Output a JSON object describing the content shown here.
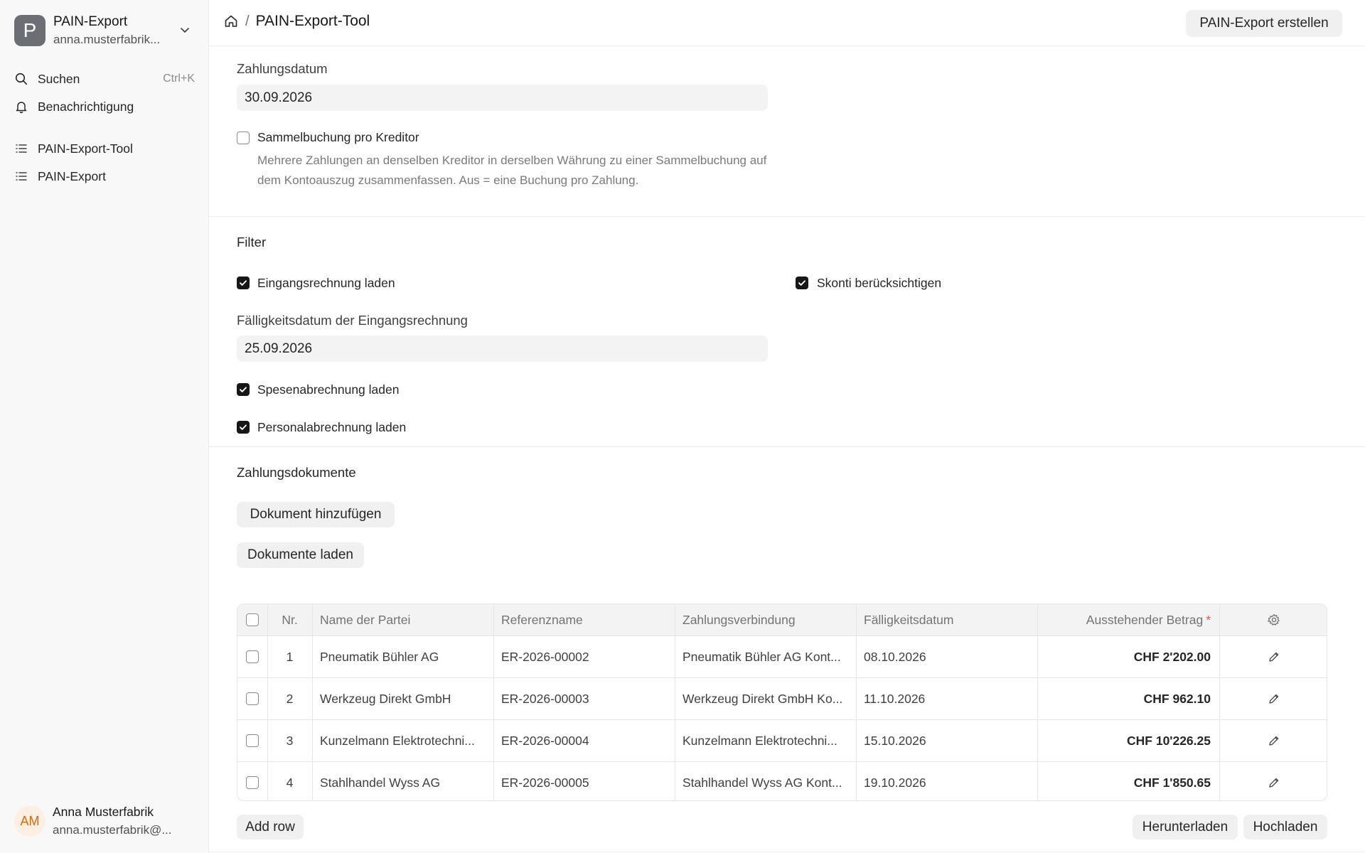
{
  "sidebar": {
    "workspace": {
      "logo_letter": "P",
      "title": "PAIN-Export",
      "subtitle": "anna.musterfabrik..."
    },
    "search": {
      "label": "Suchen",
      "shortcut": "Ctrl+K"
    },
    "notifications": {
      "label": "Benachrichtigung"
    },
    "items": [
      {
        "label": "PAIN-Export-Tool"
      },
      {
        "label": "PAIN-Export"
      }
    ],
    "user": {
      "initials": "AM",
      "name": "Anna Musterfabrik",
      "email": "anna.musterfabrik@..."
    }
  },
  "header": {
    "breadcrumb_current": "PAIN-Export-Tool",
    "primary_action": "PAIN-Export erstellen"
  },
  "form": {
    "payment_date": {
      "label": "Zahlungsdatum",
      "value": "30.09.2026"
    },
    "collective_booking": {
      "label": "Sammelbuchung pro Kreditor",
      "checked": false,
      "description": "Mehrere Zahlungen an denselben Kreditor in derselben Währung zu einer Sammelbuchung auf dem Kontoauszug zusammenfassen. Aus = eine Buchung pro Zahlung."
    },
    "filter": {
      "title": "Filter",
      "load_purchase_invoices": {
        "label": "Eingangsrechnung laden",
        "checked": true
      },
      "consider_discounts": {
        "label": "Skonti berücksichtigen",
        "checked": true
      },
      "due_date": {
        "label": "Fälligkeitsdatum der Eingangsrechnung",
        "value": "25.09.2026"
      },
      "load_expense_claims": {
        "label": "Spesenabrechnung laden",
        "checked": true
      },
      "load_payroll": {
        "label": "Personalabrechnung laden",
        "checked": true
      }
    },
    "documents": {
      "title": "Zahlungsdokumente",
      "add_button": "Dokument hinzufügen",
      "load_button": "Dokumente laden",
      "columns": [
        "Nr.",
        "Name der Partei",
        "Referenzname",
        "Zahlungsverbindung",
        "Fälligkeitsdatum",
        "Ausstehender Betrag"
      ],
      "required_marker": "*",
      "rows": [
        {
          "nr": "1",
          "party": "Pneumatik Bühler AG",
          "reference": "ER-2026-00002",
          "account": "Pneumatik Bühler AG Kont...",
          "due": "08.10.2026",
          "amount": "CHF 2'202.00"
        },
        {
          "nr": "2",
          "party": "Werkzeug Direkt GmbH",
          "reference": "ER-2026-00003",
          "account": "Werkzeug Direkt GmbH Ko...",
          "due": "11.10.2026",
          "amount": "CHF 962.10"
        },
        {
          "nr": "3",
          "party": "Kunzelmann Elektrotechni...",
          "reference": "ER-2026-00004",
          "account": "Kunzelmann Elektrotechni...",
          "due": "15.10.2026",
          "amount": "CHF 10'226.25"
        },
        {
          "nr": "4",
          "party": "Stahlhandel Wyss AG",
          "reference": "ER-2026-00005",
          "account": "Stahlhandel Wyss AG Kont...",
          "due": "19.10.2026",
          "amount": "CHF 1'850.65"
        }
      ],
      "add_row": "Add row",
      "download": "Herunterladen",
      "upload": "Hochladen"
    }
  }
}
